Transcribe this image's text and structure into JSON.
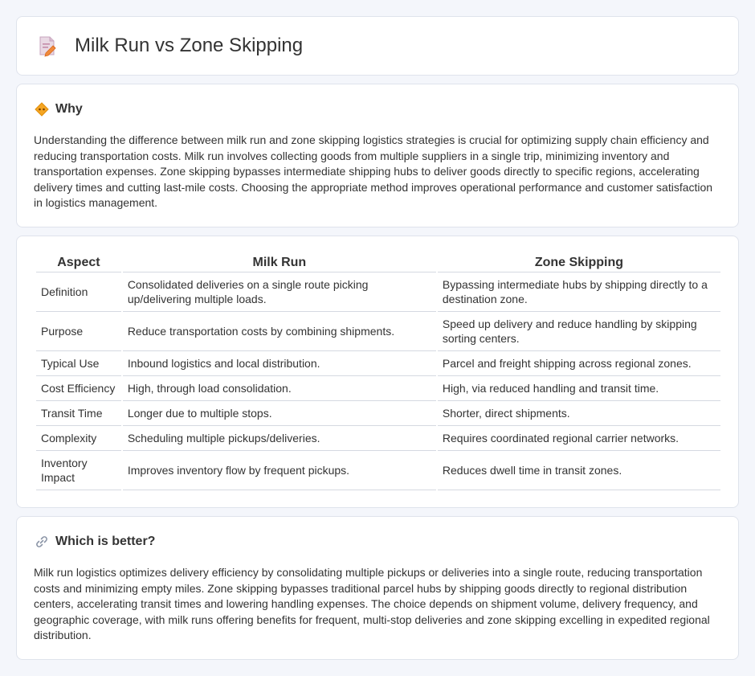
{
  "page": {
    "title": "Milk Run vs Zone Skipping",
    "title_icon": "document-pencil-icon"
  },
  "why": {
    "icon": "diamond-warning-icon",
    "heading": "Why",
    "text": "Understanding the difference between milk run and zone skipping logistics strategies is crucial for optimizing supply chain efficiency and reducing transportation costs. Milk run involves collecting goods from multiple suppliers in a single trip, minimizing inventory and transportation expenses. Zone skipping bypasses intermediate shipping hubs to deliver goods directly to specific regions, accelerating delivery times and cutting last-mile costs. Choosing the appropriate method improves operational performance and customer satisfaction in logistics management."
  },
  "comparison": {
    "headers": [
      "Aspect",
      "Milk Run",
      "Zone Skipping"
    ],
    "rows": [
      [
        "Definition",
        "Consolidated deliveries on a single route picking up/delivering multiple loads.",
        "Bypassing intermediate hubs by shipping directly to a destination zone."
      ],
      [
        "Purpose",
        "Reduce transportation costs by combining shipments.",
        "Speed up delivery and reduce handling by skipping sorting centers."
      ],
      [
        "Typical Use",
        "Inbound logistics and local distribution.",
        "Parcel and freight shipping across regional zones."
      ],
      [
        "Cost Efficiency",
        "High, through load consolidation.",
        "High, via reduced handling and transit time."
      ],
      [
        "Transit Time",
        "Longer due to multiple stops.",
        "Shorter, direct shipments."
      ],
      [
        "Complexity",
        "Scheduling multiple pickups/deliveries.",
        "Requires coordinated regional carrier networks."
      ],
      [
        "Inventory Impact",
        "Improves inventory flow by frequent pickups.",
        "Reduces dwell time in transit zones."
      ]
    ]
  },
  "better": {
    "icon": "link-icon",
    "heading": "Which is better?",
    "text": "Milk run logistics optimizes delivery efficiency by consolidating multiple pickups or deliveries into a single route, reducing transportation costs and minimizing empty miles. Zone skipping bypasses traditional parcel hubs by shipping goods directly to regional distribution centers, accelerating transit times and lowering handling expenses. The choice depends on shipment volume, delivery frequency, and geographic coverage, with milk runs offering benefits for frequent, multi-stop deliveries and zone skipping excelling in expedited regional distribution."
  }
}
